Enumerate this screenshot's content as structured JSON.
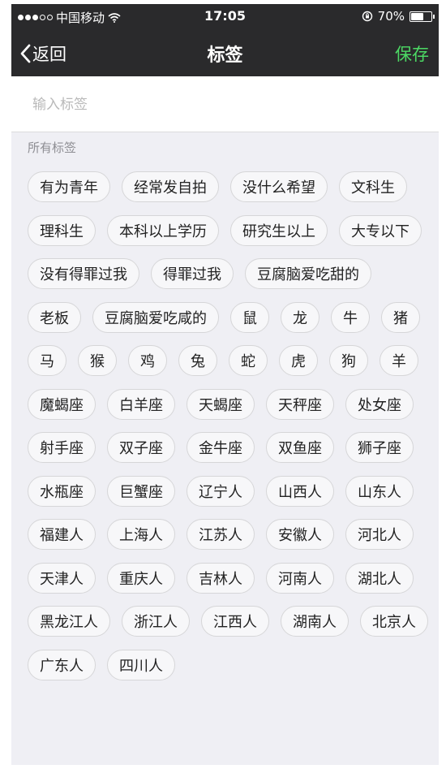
{
  "status_bar": {
    "carrier": "中国移动",
    "time": "17:05",
    "battery_percent": "70%",
    "battery_level": 0.7,
    "icons": [
      "signal-dots-icon",
      "wifi-icon",
      "rotation-lock-icon",
      "battery-icon"
    ]
  },
  "nav": {
    "back_label": "返回",
    "title": "标签",
    "save_label": "保存",
    "accent_color": "#4cd964"
  },
  "input": {
    "placeholder": "输入标签",
    "value": ""
  },
  "section_title": "所有标签",
  "tags": [
    "有为青年",
    "经常发自拍",
    "没什么希望",
    "文科生",
    "理科生",
    "本科以上学历",
    "研究生以上",
    "大专以下",
    "没有得罪过我",
    "得罪过我",
    "豆腐脑爱吃甜的",
    "老板",
    "豆腐脑爱吃咸的",
    "鼠",
    "龙",
    "牛",
    "猪",
    "马",
    "猴",
    "鸡",
    "兔",
    "蛇",
    "虎",
    "狗",
    "羊",
    "魔蝎座",
    "白羊座",
    "天蝎座",
    "天秤座",
    "处女座",
    "射手座",
    "双子座",
    "金牛座",
    "双鱼座",
    "狮子座",
    "水瓶座",
    "巨蟹座",
    "辽宁人",
    "山西人",
    "山东人",
    "福建人",
    "上海人",
    "江苏人",
    "安徽人",
    "河北人",
    "天津人",
    "重庆人",
    "吉林人",
    "河南人",
    "湖北人",
    "黑龙江人",
    "浙江人",
    "江西人",
    "湖南人",
    "北京人",
    "广东人",
    "四川人"
  ]
}
